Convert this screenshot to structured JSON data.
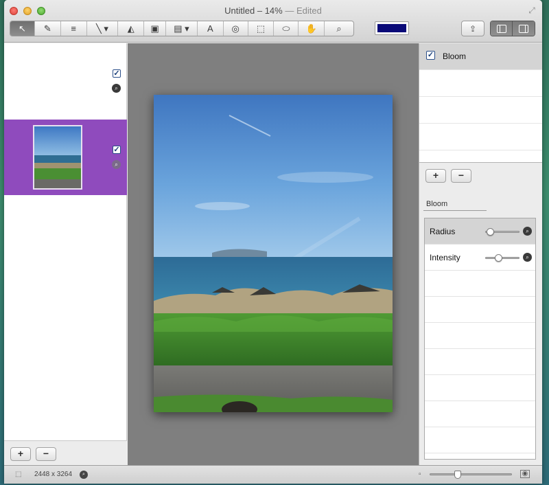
{
  "window": {
    "title": "Untitled – 14%",
    "edited_suffix": "— Edited"
  },
  "toolbar": {
    "tools": [
      {
        "name": "select-tool",
        "icon": "arrow-cursor-icon",
        "glyph": "↖",
        "active": true
      },
      {
        "name": "brush-tool",
        "icon": "paintbrush-icon",
        "glyph": "✎",
        "active": false
      },
      {
        "name": "multi-brush-tool",
        "icon": "multi-brush-icon",
        "glyph": "≡",
        "active": false
      },
      {
        "name": "line-tool",
        "icon": "line-icon",
        "glyph": "╲ ▾",
        "active": false
      },
      {
        "name": "eraser-tool",
        "icon": "eraser-icon",
        "glyph": "◭",
        "active": false
      },
      {
        "name": "mask-tool",
        "icon": "portrait-mask-icon",
        "glyph": "▣",
        "active": false
      },
      {
        "name": "gradient-tool",
        "icon": "gradient-icon",
        "glyph": "▤ ▾",
        "active": false
      },
      {
        "name": "text-tool",
        "icon": "text-icon",
        "glyph": "A",
        "active": false
      },
      {
        "name": "swirl-tool",
        "icon": "swirl-icon",
        "glyph": "◎",
        "active": false
      },
      {
        "name": "rect-select-tool",
        "icon": "rect-select-icon",
        "glyph": "⬚",
        "active": false
      },
      {
        "name": "lasso-tool",
        "icon": "lasso-icon",
        "glyph": "⬭",
        "active": false
      },
      {
        "name": "hand-tool",
        "icon": "hand-icon",
        "glyph": "✋",
        "active": false
      },
      {
        "name": "zoom-tool",
        "icon": "magnifier-icon",
        "glyph": "⌕",
        "active": false
      }
    ],
    "color_well": "#0a0a78",
    "share_icon": "share-icon",
    "view_icons": [
      "left-panel-icon",
      "right-panel-icon"
    ]
  },
  "layers": {
    "add_label": "+",
    "remove_label": "−",
    "magnifier_glyph": "⌕",
    "check_glyph": "✓",
    "selected_color": "#8f4bbd"
  },
  "inspector": {
    "filters": [
      {
        "label": "Bloom",
        "checked": true
      }
    ],
    "add_label": "+",
    "remove_label": "−",
    "section_title": "Bloom",
    "params": [
      {
        "label": "Radius",
        "value": 0.12
      },
      {
        "label": "Intensity",
        "value": 0.35
      }
    ]
  },
  "status": {
    "dimensions": "2448 x 3264",
    "zoom_value": 0.33
  }
}
